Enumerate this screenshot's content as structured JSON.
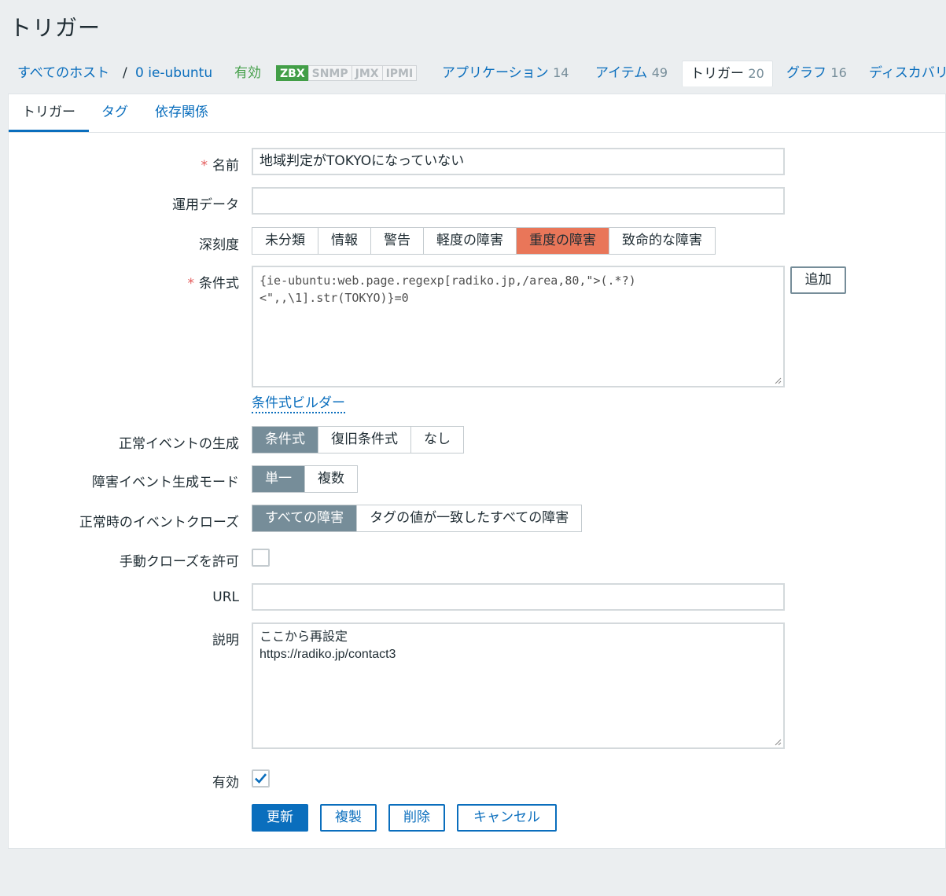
{
  "page": {
    "title": "トリガー"
  },
  "nav": {
    "all_hosts": "すべてのホスト",
    "separator": "/",
    "host": "0 ie-ubuntu",
    "status": "有効",
    "badges": [
      "ZBX",
      "SNMP",
      "JMX",
      "IPMI"
    ],
    "applications": {
      "label": "アプリケーション",
      "count": "14"
    },
    "items": {
      "label": "アイテム",
      "count": "49"
    },
    "triggers": {
      "label": "トリガー",
      "count": "20"
    },
    "graphs": {
      "label": "グラフ",
      "count": "16"
    },
    "discovery": {
      "label": "ディスカバリ"
    }
  },
  "tabs": [
    "トリガー",
    "タグ",
    "依存関係"
  ],
  "form": {
    "name": {
      "label": "名前",
      "value": "地域判定がTOKYOになっていない"
    },
    "opdata": {
      "label": "運用データ",
      "value": ""
    },
    "severity": {
      "label": "深刻度",
      "options": [
        "未分類",
        "情報",
        "警告",
        "軽度の障害",
        "重度の障害",
        "致命的な障害"
      ],
      "selected": "重度の障害"
    },
    "expression": {
      "label": "条件式",
      "value": "{ie-ubuntu:web.page.regexp[radiko.jp,/area,80,\">(.*?)\n<\",,\\1].str(TOKYO)}=0",
      "add_button": "追加",
      "builder_link": "条件式ビルダー"
    },
    "ok_event": {
      "label": "正常イベントの生成",
      "options": [
        "条件式",
        "復旧条件式",
        "なし"
      ],
      "selected": "条件式"
    },
    "problem_mode": {
      "label": "障害イベント生成モード",
      "options": [
        "単一",
        "複数"
      ],
      "selected": "単一"
    },
    "ok_close": {
      "label": "正常時のイベントクローズ",
      "options": [
        "すべての障害",
        "タグの値が一致したすべての障害"
      ],
      "selected": "すべての障害"
    },
    "manual_close": {
      "label": "手動クローズを許可",
      "checked": false
    },
    "url": {
      "label": "URL",
      "value": ""
    },
    "description": {
      "label": "説明",
      "value": "ここから再設定\nhttps://radiko.jp/contact3"
    },
    "enabled": {
      "label": "有効",
      "checked": true
    }
  },
  "buttons": {
    "update": "更新",
    "clone": "複製",
    "delete": "削除",
    "cancel": "キャンセル"
  },
  "colors": {
    "link": "#0a6ebd",
    "selected_segment": "#768d99",
    "high_severity": "#e97659",
    "enabled_green": "#429e47"
  }
}
